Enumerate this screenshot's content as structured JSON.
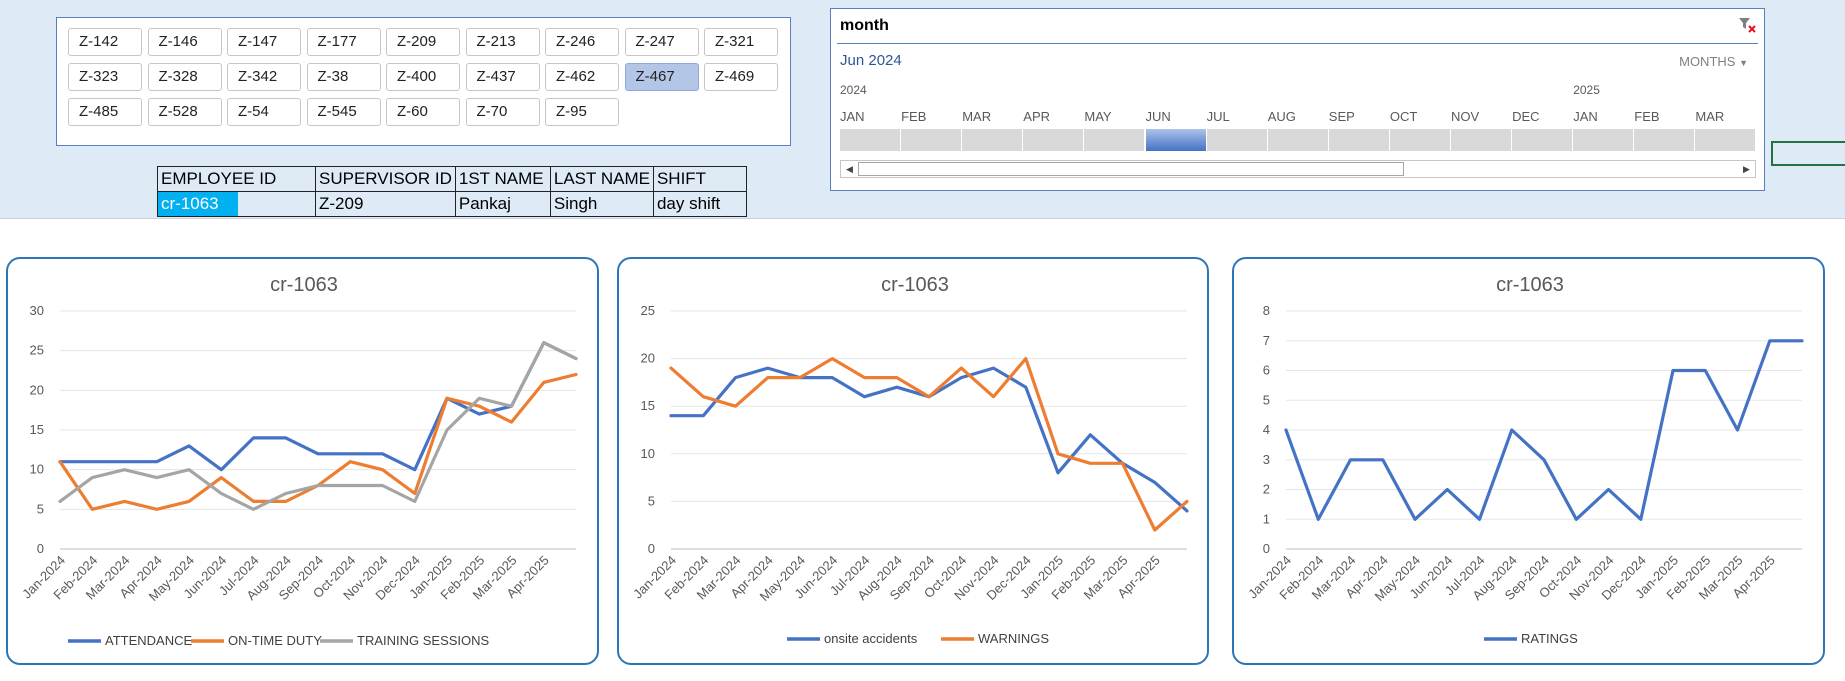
{
  "supervisor_slicer": {
    "items": [
      "Z-142",
      "Z-146",
      "Z-147",
      "Z-177",
      "Z-209",
      "Z-213",
      "Z-246",
      "Z-247",
      "Z-321",
      "Z-323",
      "Z-328",
      "Z-342",
      "Z-38",
      "Z-400",
      "Z-437",
      "Z-462",
      "Z-467",
      "Z-469",
      "Z-485",
      "Z-528",
      "Z-54",
      "Z-545",
      "Z-60",
      "Z-70",
      "Z-95"
    ],
    "selected": "Z-467"
  },
  "employee_table": {
    "headers": [
      "EMPLOYEE ID",
      "SUPERVISOR ID",
      "1ST NAME",
      "LAST NAME",
      "SHIFT"
    ],
    "row": [
      "cr-1063",
      "Z-209",
      "Pankaj",
      "Singh",
      "day shift"
    ]
  },
  "timeline": {
    "title": "month",
    "selected_period": "Jun 2024",
    "level": "MONTHS",
    "years": [
      "2024",
      "2025"
    ],
    "months": [
      "JAN",
      "FEB",
      "MAR",
      "APR",
      "MAY",
      "JUN",
      "JUL",
      "AUG",
      "SEP",
      "OCT",
      "NOV",
      "DEC",
      "JAN",
      "FEB",
      "MAR"
    ],
    "selected_month_index": 5
  },
  "chart_data": [
    {
      "type": "line",
      "title": "cr-1063",
      "categories": [
        "Jan-2024",
        "Feb-2024",
        "Mar-2024",
        "Apr-2024",
        "May-2024",
        "Jun-2024",
        "Jul-2024",
        "Aug-2024",
        "Sep-2024",
        "Oct-2024",
        "Nov-2024",
        "Dec-2024",
        "Jan-2025",
        "Feb-2025",
        "Mar-2025",
        "Apr-2025"
      ],
      "ylim": [
        0,
        30
      ],
      "yticks": [
        0,
        5,
        10,
        15,
        20,
        25,
        30
      ],
      "grid": true,
      "legend": "bottom",
      "series": [
        {
          "name": "ATTENDANCE",
          "color": "#4472c4",
          "values": [
            11,
            11,
            11,
            11,
            13,
            10,
            14,
            14,
            12,
            12,
            12,
            10,
            19,
            17,
            18,
            26,
            24
          ]
        },
        {
          "name": "ON-TIME DUTY",
          "color": "#ed7d31",
          "values": [
            11,
            5,
            6,
            5,
            6,
            9,
            6,
            6,
            8,
            11,
            10,
            7,
            19,
            18,
            16,
            21,
            22
          ]
        },
        {
          "name": "TRAINING SESSIONS",
          "color": "#a5a5a5",
          "values": [
            6,
            9,
            10,
            9,
            10,
            7,
            5,
            7,
            8,
            8,
            8,
            6,
            15,
            19,
            18,
            26,
            24
          ]
        }
      ]
    },
    {
      "type": "line",
      "title": "cr-1063",
      "categories": [
        "Jan-2024",
        "Feb-2024",
        "Mar-2024",
        "Apr-2024",
        "May-2024",
        "Jun-2024",
        "Jul-2024",
        "Aug-2024",
        "Sep-2024",
        "Oct-2024",
        "Nov-2024",
        "Dec-2024",
        "Jan-2025",
        "Feb-2025",
        "Mar-2025",
        "Apr-2025"
      ],
      "ylim": [
        0,
        25
      ],
      "yticks": [
        0,
        5,
        10,
        15,
        20,
        25
      ],
      "grid": true,
      "legend": "bottom",
      "series": [
        {
          "name": "onsite accidents",
          "color": "#4472c4",
          "values": [
            14,
            14,
            18,
            19,
            18,
            18,
            16,
            17,
            16,
            18,
            19,
            17,
            8,
            12,
            9,
            7,
            4
          ]
        },
        {
          "name": "WARNINGS",
          "color": "#ed7d31",
          "values": [
            19,
            16,
            15,
            18,
            18,
            20,
            18,
            18,
            16,
            19,
            16,
            20,
            10,
            9,
            9,
            2,
            5
          ]
        }
      ]
    },
    {
      "type": "line",
      "title": "cr-1063",
      "categories": [
        "Jan-2024",
        "Feb-2024",
        "Mar-2024",
        "Apr-2024",
        "May-2024",
        "Jun-2024",
        "Jul-2024",
        "Aug-2024",
        "Sep-2024",
        "Oct-2024",
        "Nov-2024",
        "Dec-2024",
        "Jan-2025",
        "Feb-2025",
        "Mar-2025",
        "Apr-2025"
      ],
      "ylim": [
        0,
        8
      ],
      "yticks": [
        0,
        1,
        2,
        3,
        4,
        5,
        6,
        7,
        8
      ],
      "grid": true,
      "legend": "bottom",
      "series": [
        {
          "name": "RATINGS",
          "color": "#4472c4",
          "values": [
            4,
            1,
            3,
            3,
            1,
            2,
            1,
            4,
            3,
            1,
            2,
            1,
            6,
            6,
            4,
            7,
            7
          ]
        }
      ]
    }
  ]
}
